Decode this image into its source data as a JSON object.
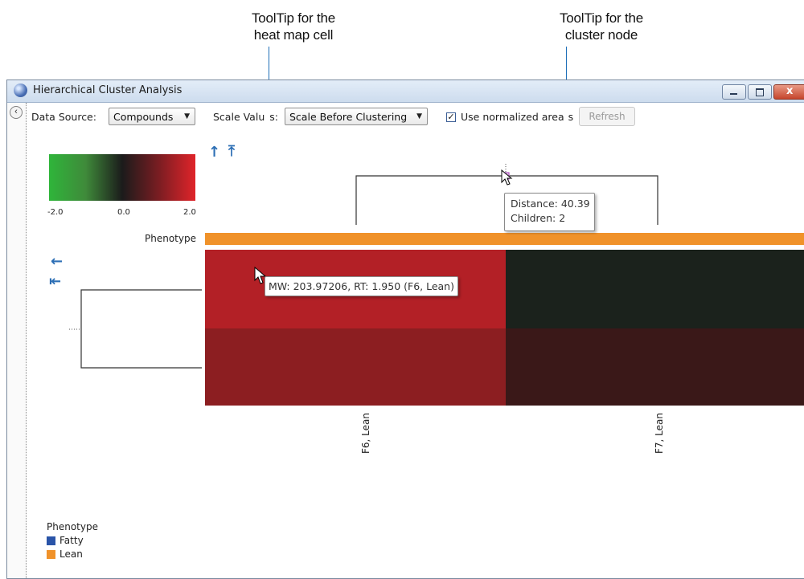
{
  "callouts": {
    "heatmap_cell": "ToolTip for the\nheat map cell",
    "cluster_node": "ToolTip for the\ncluster node"
  },
  "window": {
    "title": "Hierarchical Cluster Analysis"
  },
  "toolbar": {
    "collapse_glyph": "‹",
    "data_source_label": "Data Source:",
    "data_source_value": "Compounds",
    "scale_values_label": "Scale Valu",
    "scale_values_label_tail": "s:",
    "scale_values_value": "Scale Before Clustering",
    "normalized_checked_glyph": "✓",
    "normalized_label": "Use normalized area",
    "normalized_label_tail": "s",
    "refresh_label": "Refresh"
  },
  "color_scale": {
    "min": "-2.0",
    "mid": "0.0",
    "max": "2.0",
    "low_color": "#2fb53a",
    "zero_color": "#1b1b1b",
    "high_color": "#e0242a"
  },
  "heatmap": {
    "row_annotation_label": "Phenotype",
    "annotation_color": "#f0922a",
    "columns": [
      "F6, Lean",
      "F7, Lean"
    ],
    "cell_colors": [
      [
        "#b32026",
        "#1b221c"
      ],
      [
        "#8c1e21",
        "#3a1818"
      ]
    ]
  },
  "tooltips": {
    "cell": "MW: 203.97206, RT: 1.950 (F6, Lean)",
    "node_distance": "Distance: 40.39",
    "node_children": "Children: 2"
  },
  "legend": {
    "title": "Phenotype",
    "items": [
      {
        "label": "Fatty",
        "color": "#2a54a8"
      },
      {
        "label": "Lean",
        "color": "#f0922a"
      }
    ]
  }
}
